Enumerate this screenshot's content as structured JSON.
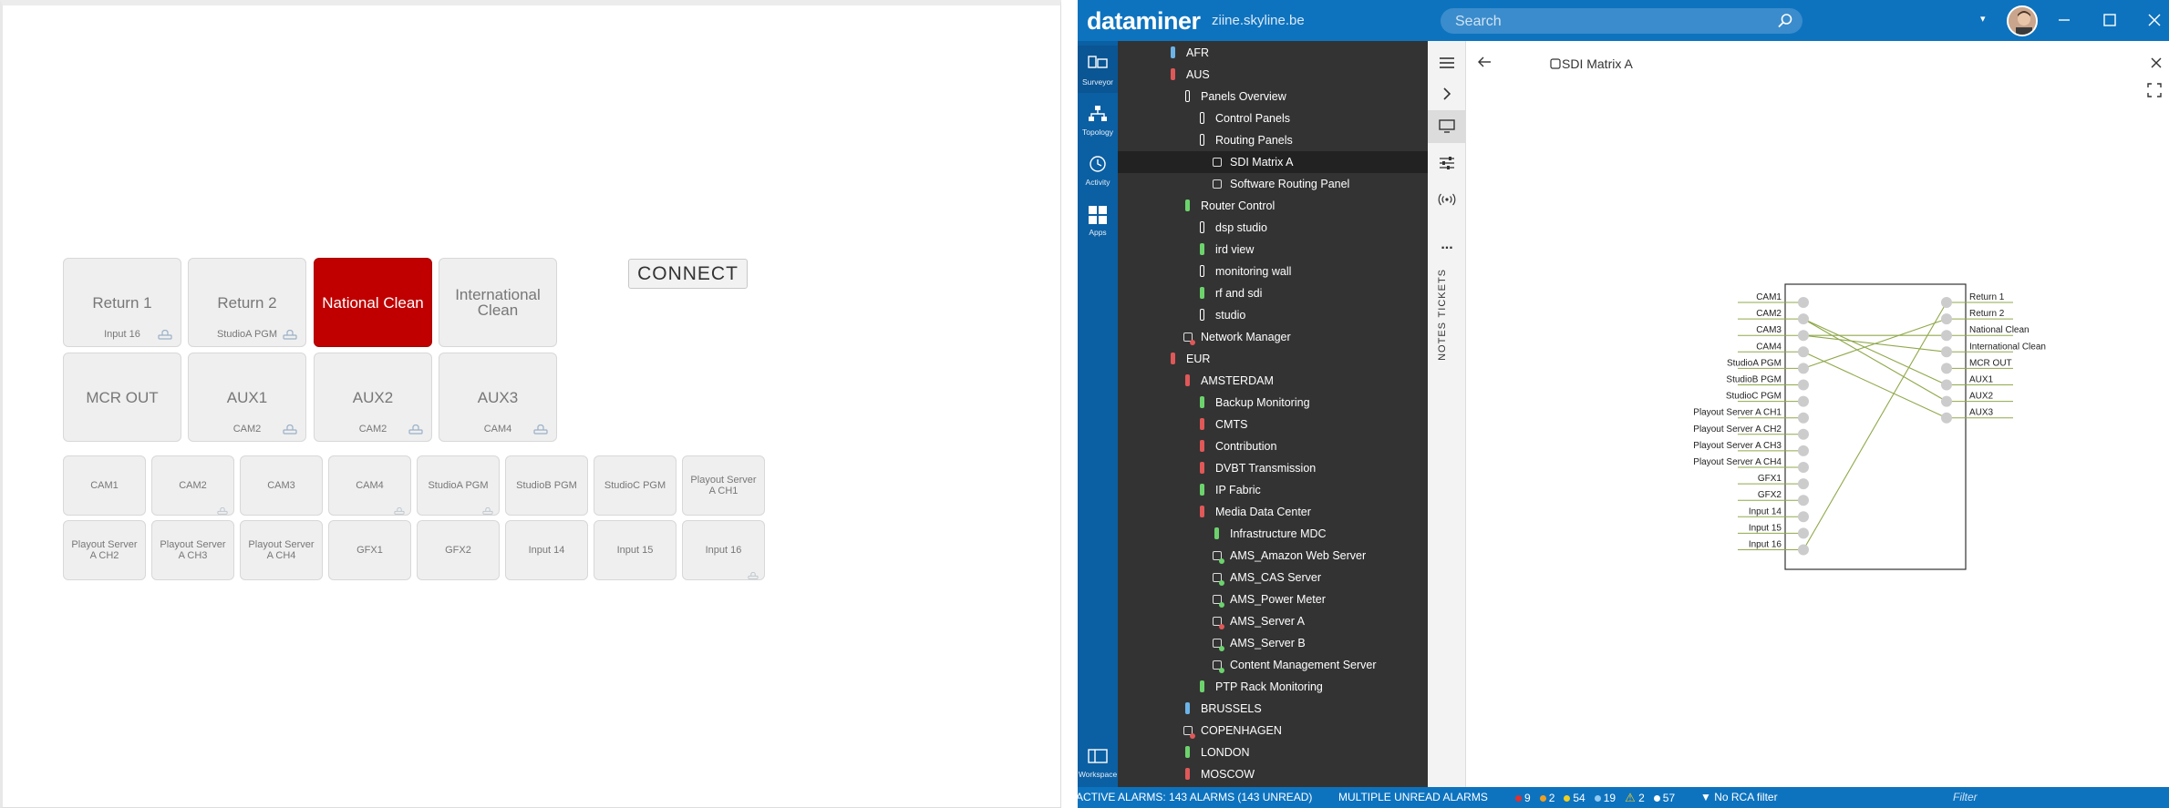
{
  "left_panel": {
    "big_tiles": [
      {
        "label": "Return 1",
        "sub": "Input 16",
        "icon": "lock-icon",
        "state": "normal"
      },
      {
        "label": "Return 2",
        "sub": "StudioA PGM",
        "icon": "lock-icon",
        "state": "normal"
      },
      {
        "label": "National Clean",
        "sub": "",
        "icon": "",
        "state": "selected"
      },
      {
        "label": "International Clean",
        "sub": "",
        "icon": "",
        "state": "normal"
      },
      {
        "label": "MCR OUT",
        "sub": "",
        "icon": "",
        "state": "normal"
      },
      {
        "label": "AUX1",
        "sub": "CAM2",
        "icon": "lock-icon",
        "state": "normal"
      },
      {
        "label": "AUX2",
        "sub": "CAM2",
        "icon": "lock-icon",
        "state": "normal"
      },
      {
        "label": "AUX3",
        "sub": "CAM4",
        "icon": "lock-icon",
        "state": "normal"
      }
    ],
    "connect_label": "CONNECT",
    "small_tiles": [
      {
        "label": "CAM1",
        "icon": ""
      },
      {
        "label": "CAM2",
        "icon": "lock-icon"
      },
      {
        "label": "CAM3",
        "icon": ""
      },
      {
        "label": "CAM4",
        "icon": "lock-icon"
      },
      {
        "label": "StudioA PGM",
        "icon": "lock-icon"
      },
      {
        "label": "StudioB PGM",
        "icon": ""
      },
      {
        "label": "StudioC PGM",
        "icon": ""
      },
      {
        "label": "Playout Server A CH1",
        "icon": ""
      },
      {
        "label": "Playout Server A CH2",
        "icon": ""
      },
      {
        "label": "Playout Server A CH3",
        "icon": ""
      },
      {
        "label": "Playout Server A CH4",
        "icon": ""
      },
      {
        "label": "GFX1",
        "icon": ""
      },
      {
        "label": "GFX2",
        "icon": ""
      },
      {
        "label": "Input 14",
        "icon": ""
      },
      {
        "label": "Input 15",
        "icon": ""
      },
      {
        "label": "Input 16",
        "icon": "lock-icon"
      }
    ]
  },
  "app": {
    "brand": "dataminer",
    "host": "ziine.skyline.be",
    "search_placeholder": "Search",
    "nav": [
      {
        "label": "Surveyor",
        "icon": "surveyor-icon",
        "active": true
      },
      {
        "label": "Topology",
        "icon": "topology-icon",
        "active": false
      },
      {
        "label": "Activity",
        "icon": "activity-icon",
        "active": false
      },
      {
        "label": "Apps",
        "icon": "apps-icon",
        "active": false
      },
      {
        "label": "Workspace",
        "icon": "workspace-icon",
        "active": false
      }
    ],
    "tree": [
      {
        "label": "AFR",
        "indent": 0,
        "kind": "bar",
        "color": "#6cb4e8"
      },
      {
        "label": "AUS",
        "indent": 0,
        "kind": "bar",
        "color": "#e05858"
      },
      {
        "label": "Panels Overview",
        "indent": 1,
        "kind": "bar",
        "color": "#ffffff"
      },
      {
        "label": "Control Panels",
        "indent": 2,
        "kind": "bar",
        "color": "#ffffff"
      },
      {
        "label": "Routing Panels",
        "indent": 2,
        "kind": "bar",
        "color": "#ffffff"
      },
      {
        "label": "SDI Matrix A",
        "indent": 3,
        "kind": "box",
        "color": "#ffffff",
        "selected": true
      },
      {
        "label": "Software Routing Panel",
        "indent": 3,
        "kind": "box",
        "color": "#ffffff"
      },
      {
        "label": "Router Control",
        "indent": 1,
        "kind": "bar",
        "color": "#6cd36c"
      },
      {
        "label": "dsp studio",
        "indent": 2,
        "kind": "bar",
        "color": "#ffffff"
      },
      {
        "label": "ird view",
        "indent": 2,
        "kind": "bar",
        "color": "#6cd36c"
      },
      {
        "label": "monitoring wall",
        "indent": 2,
        "kind": "bar",
        "color": "#ffffff"
      },
      {
        "label": "rf and sdi",
        "indent": 2,
        "kind": "bar",
        "color": "#6cd36c"
      },
      {
        "label": "studio",
        "indent": 2,
        "kind": "bar",
        "color": "#ffffff"
      },
      {
        "label": "Network Manager",
        "indent": 1,
        "kind": "element",
        "color": "#e05858"
      },
      {
        "label": "EUR",
        "indent": 0,
        "kind": "bar",
        "color": "#e05858"
      },
      {
        "label": "AMSTERDAM",
        "indent": 1,
        "kind": "bar",
        "color": "#e05858"
      },
      {
        "label": "Backup Monitoring",
        "indent": 2,
        "kind": "bar",
        "color": "#6cd36c"
      },
      {
        "label": "CMTS",
        "indent": 2,
        "kind": "bar",
        "color": "#e05858"
      },
      {
        "label": "Contribution",
        "indent": 2,
        "kind": "bar",
        "color": "#e05858"
      },
      {
        "label": "DVBT Transmission",
        "indent": 2,
        "kind": "bar",
        "color": "#e05858"
      },
      {
        "label": "IP Fabric",
        "indent": 2,
        "kind": "bar",
        "color": "#6cd36c"
      },
      {
        "label": "Media Data Center",
        "indent": 2,
        "kind": "bar",
        "color": "#e05858"
      },
      {
        "label": "Infrastructure MDC",
        "indent": 3,
        "kind": "bar",
        "color": "#6cd36c"
      },
      {
        "label": "AMS_Amazon Web Server",
        "indent": 3,
        "kind": "element",
        "color": "#6cd36c"
      },
      {
        "label": "AMS_CAS Server",
        "indent": 3,
        "kind": "element",
        "color": "#6cd36c"
      },
      {
        "label": "AMS_Power Meter",
        "indent": 3,
        "kind": "element",
        "color": "#6cd36c"
      },
      {
        "label": "AMS_Server A",
        "indent": 3,
        "kind": "element",
        "color": "#e05858"
      },
      {
        "label": "AMS_Server B",
        "indent": 3,
        "kind": "element",
        "color": "#6cd36c"
      },
      {
        "label": "Content Management Server",
        "indent": 3,
        "kind": "element",
        "color": "#6cd36c"
      },
      {
        "label": "PTP Rack Monitoring",
        "indent": 2,
        "kind": "bar",
        "color": "#6cd36c"
      },
      {
        "label": "BRUSSELS",
        "indent": 1,
        "kind": "bar",
        "color": "#6cb4e8"
      },
      {
        "label": "COPENHAGEN",
        "indent": 1,
        "kind": "element",
        "color": "#e05858"
      },
      {
        "label": "LONDON",
        "indent": 1,
        "kind": "bar",
        "color": "#6cd36c"
      },
      {
        "label": "MOSCOW",
        "indent": 1,
        "kind": "bar",
        "color": "#e05858"
      }
    ],
    "side_tabs": {
      "tickets": "TICKETS",
      "notes": "NOTES",
      "more": "..."
    },
    "card_title": "SDI Matrix A",
    "matrix": {
      "inputs": [
        "CAM1",
        "CAM2",
        "CAM3",
        "CAM4",
        "StudioA PGM",
        "StudioB PGM",
        "StudioC PGM",
        "Playout Server A CH1",
        "Playout Server A CH2",
        "Playout Server A CH3",
        "Playout Server A CH4",
        "GFX1",
        "GFX2",
        "Input 14",
        "Input 15",
        "Input 16"
      ],
      "outputs": [
        "Return 1",
        "Return 2",
        "National Clean",
        "International Clean",
        "MCR OUT",
        "AUX1",
        "AUX2",
        "AUX3"
      ],
      "connections": [
        [
          16,
          1
        ],
        [
          5,
          2
        ],
        [
          2,
          6
        ],
        [
          2,
          7
        ],
        [
          4,
          8
        ],
        [
          3,
          3
        ],
        [
          3,
          4
        ]
      ]
    },
    "status": {
      "alarms": "ACTIVE ALARMS: 143 ALARMS (143 UNREAD)",
      "unread": "MULTIPLE UNREAD ALARMS",
      "counts": [
        {
          "value": "9",
          "color": "#e03030"
        },
        {
          "value": "2",
          "color": "#f0a020"
        },
        {
          "value": "54",
          "color": "#f0d020"
        },
        {
          "value": "19",
          "color": "#8fc8f0"
        },
        {
          "value": "2",
          "color": "#f0d020"
        },
        {
          "value": "57",
          "color": "#ffffff"
        }
      ],
      "rca": "No RCA filter",
      "filter_placeholder": "Filter"
    }
  }
}
